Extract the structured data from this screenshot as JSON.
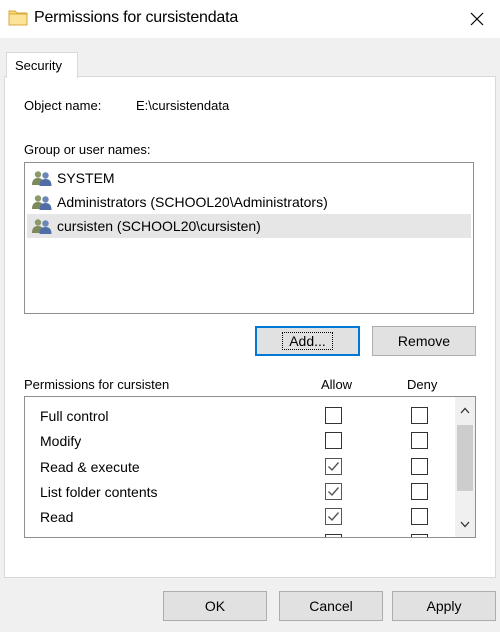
{
  "window": {
    "title": "Permissions for cursistendata",
    "close_label": "Close"
  },
  "tab": {
    "label": "Security"
  },
  "object": {
    "label": "Object name:",
    "value": "E:\\cursistendata"
  },
  "group": {
    "label": "Group or user names:",
    "items": [
      {
        "name": "SYSTEM",
        "icon": "users-icon",
        "selected": false
      },
      {
        "name": "Administrators (SCHOOL20\\Administrators)",
        "icon": "users-icon",
        "selected": false
      },
      {
        "name": "cursisten (SCHOOL20\\cursisten)",
        "icon": "users-icon",
        "selected": true
      }
    ],
    "add_label": "Add...",
    "remove_label": "Remove"
  },
  "permissions": {
    "label": "Permissions for cursisten",
    "allow_header": "Allow",
    "deny_header": "Deny",
    "rows": [
      {
        "name": "Full control",
        "allow": false,
        "deny": false
      },
      {
        "name": "Modify",
        "allow": false,
        "deny": false
      },
      {
        "name": "Read & execute",
        "allow": true,
        "deny": false
      },
      {
        "name": "List folder contents",
        "allow": true,
        "deny": false
      },
      {
        "name": "Read",
        "allow": true,
        "deny": false
      }
    ]
  },
  "footer": {
    "ok_label": "OK",
    "cancel_label": "Cancel",
    "apply_label": "Apply"
  },
  "colors": {
    "accent": "#0078d7",
    "selection": "#e6e6e6",
    "folder": "#f8d775"
  }
}
